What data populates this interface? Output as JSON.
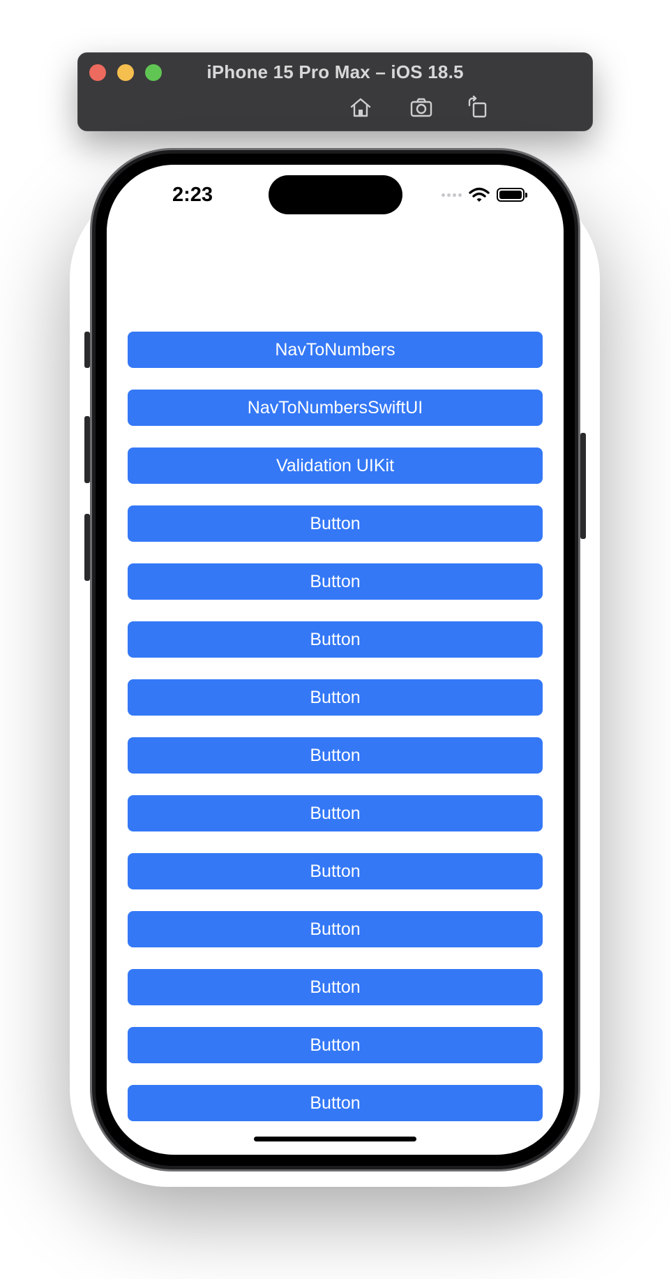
{
  "simulator": {
    "title": "iPhone 15 Pro Max – iOS 18.5",
    "tools": [
      {
        "icon": "home-icon"
      },
      {
        "icon": "camera-icon"
      },
      {
        "icon": "rotate-icon"
      }
    ]
  },
  "status_bar": {
    "time": "2:23",
    "icons": [
      "signal-dots-icon",
      "wifi-icon",
      "battery-icon"
    ],
    "battery_level": 1.0
  },
  "buttons": [
    {
      "label": "NavToNumbers"
    },
    {
      "label": "NavToNumbersSwiftUI"
    },
    {
      "label": "Validation UIKit"
    },
    {
      "label": "Button"
    },
    {
      "label": "Button"
    },
    {
      "label": "Button"
    },
    {
      "label": "Button"
    },
    {
      "label": "Button"
    },
    {
      "label": "Button"
    },
    {
      "label": "Button"
    },
    {
      "label": "Button"
    },
    {
      "label": "Button"
    },
    {
      "label": "Button"
    },
    {
      "label": "Button"
    }
  ],
  "colors": {
    "button_background": "#3478f6",
    "button_text": "#ffffff",
    "titlebar": "#3a3a3c"
  }
}
